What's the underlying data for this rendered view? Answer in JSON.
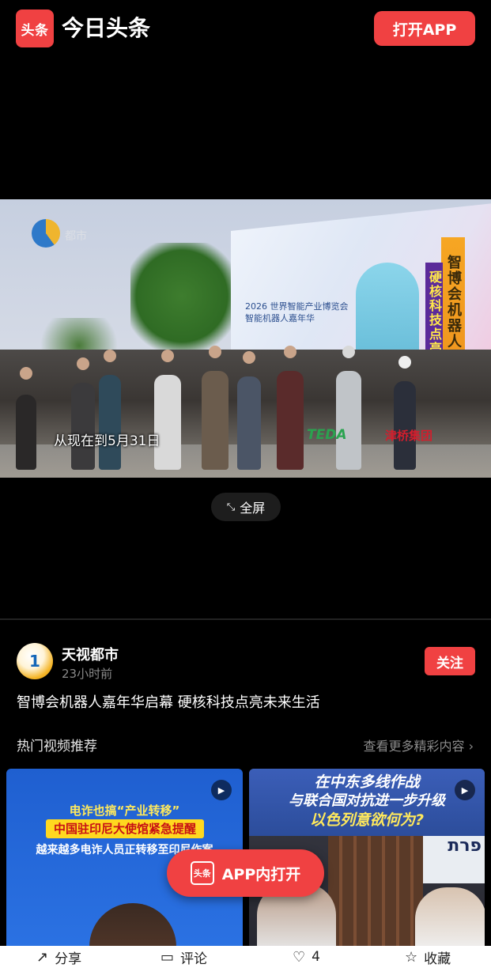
{
  "header": {
    "logo_text": "头条",
    "app_name": "今日头条",
    "open_app_label": "打开APP"
  },
  "video": {
    "caption": "从现在到5月31日",
    "station_text": "都市",
    "billboard_line1": "2026 世界智能产业博览会",
    "billboard_line2": "智能机器人嘉年华",
    "banner_text1": "智博会机器人嘉年华启幕",
    "banner_text2": "硬核科技点亮未来生活",
    "sponsor1": "TEDA",
    "sponsor2": "津桥集团",
    "fullscreen_label": "全屏"
  },
  "author": {
    "name": "天视都市",
    "time": "23小时前",
    "follow_label": "关注"
  },
  "article": {
    "title": "智博会机器人嘉年华启幕 硬核科技点亮未来生活"
  },
  "recommend": {
    "header": "热门视频推荐",
    "more": "查看更多精彩内容",
    "cards": [
      {
        "line1": "电诈也搞“产业转移”",
        "line2": "中国驻印尼大使馆紧急提醒",
        "line3": "越来越多电诈人员正转移至印尼作案"
      },
      {
        "line1": "在中东多线作战",
        "line2": "与联合国对抗进一步升级",
        "line3": "以色列意欲何为?",
        "sign": "פרת"
      }
    ]
  },
  "float_button": {
    "logo_text": "头条",
    "label": "APP内打开"
  },
  "bottom_bar": {
    "share": "分享",
    "comment": "评论",
    "like_count": "4",
    "favorite": "收藏"
  }
}
